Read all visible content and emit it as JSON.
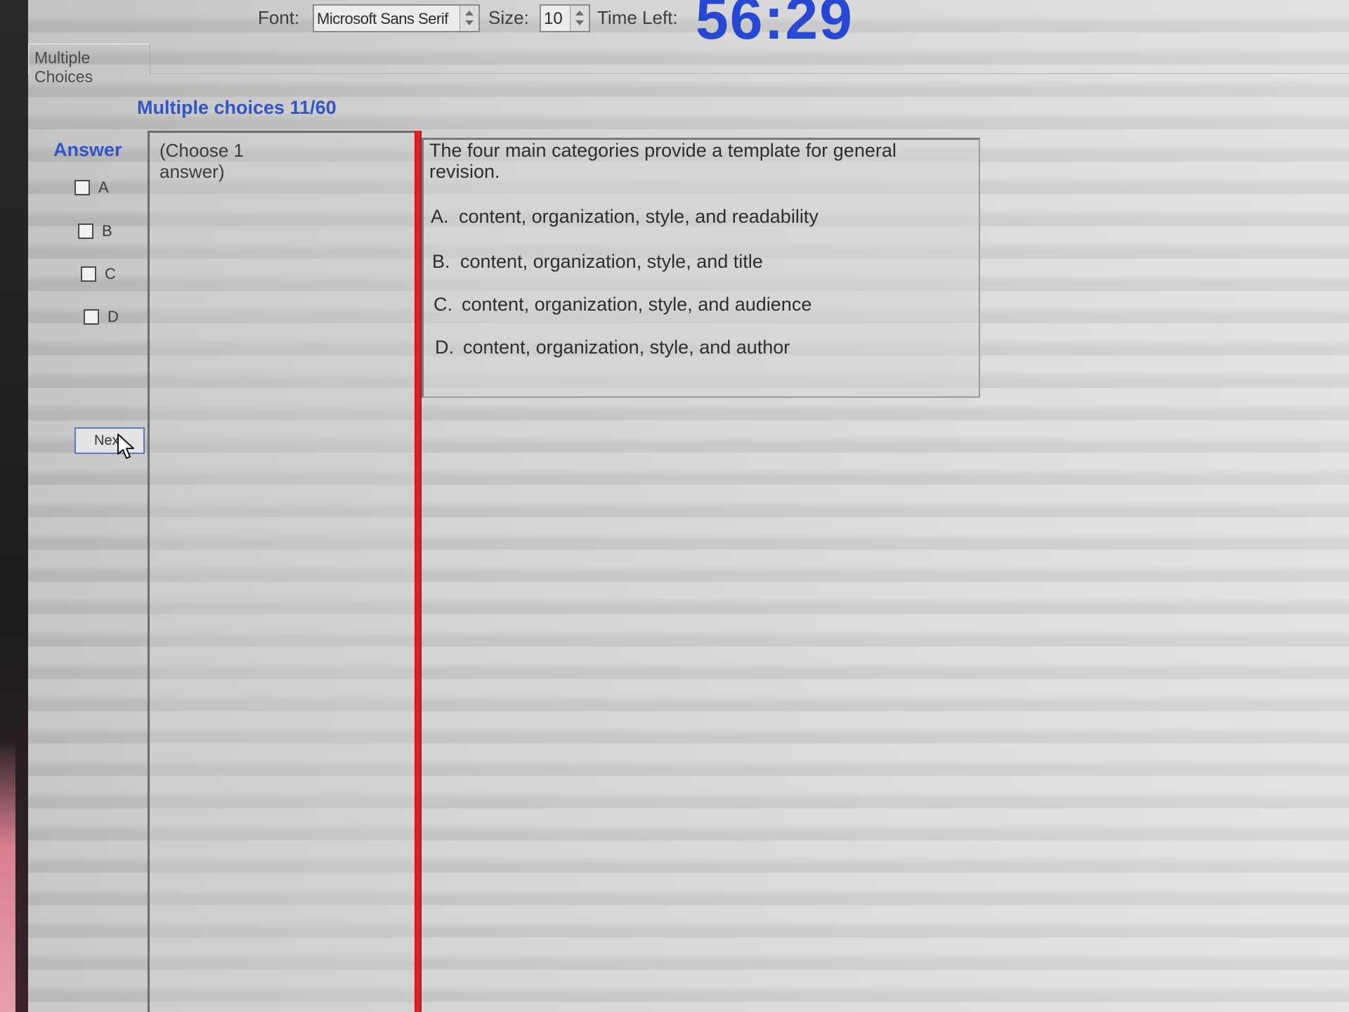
{
  "toolbar": {
    "font_label": "Font:",
    "font_value": "Microsoft Sans Serif",
    "size_label": "Size:",
    "size_value": "10",
    "time_label": "Time Left:",
    "time_left": "56:29"
  },
  "tab": {
    "label": "Multiple Choices"
  },
  "heading": "Multiple choices 11/60",
  "answer_panel": {
    "title": "Answer",
    "options": [
      {
        "letter": "A",
        "checked": false
      },
      {
        "letter": "B",
        "checked": false
      },
      {
        "letter": "C",
        "checked": false
      },
      {
        "letter": "D",
        "checked": false
      }
    ],
    "next_label": "Next"
  },
  "instructions": {
    "text": "(Choose 1 answer)"
  },
  "question": {
    "text": "The four main categories provide a template for general revision.",
    "options": [
      {
        "letter": "A.",
        "text": "content, organization, style, and readability"
      },
      {
        "letter": "B.",
        "text": "content, organization, style, and title"
      },
      {
        "letter": "C.",
        "text": "content, organization, style, and audience"
      },
      {
        "letter": "D.",
        "text": "content, organization, style, and author"
      }
    ]
  },
  "colors": {
    "accent_blue": "#2f55c9",
    "timer_blue": "#2748d4",
    "divider_red": "#e1272d"
  },
  "icons": {
    "cursor": "arrow-pointer-icon"
  }
}
